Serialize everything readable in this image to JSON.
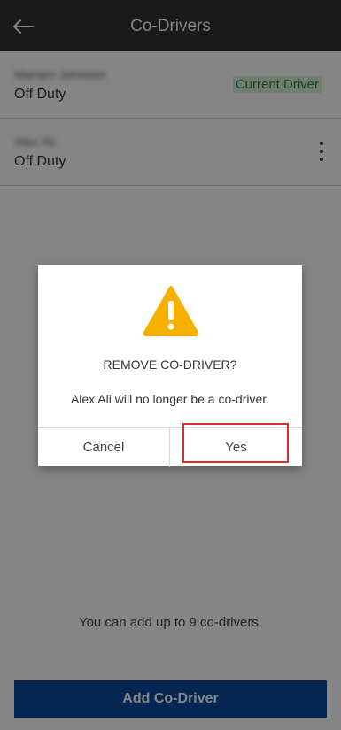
{
  "header": {
    "title": "Co-Drivers",
    "back_icon": "arrow-left-icon"
  },
  "drivers": [
    {
      "name": "Maham Johnson",
      "status": "Off Duty",
      "badge": "Current Driver"
    },
    {
      "name": "Alex Ali",
      "status": "Off Duty",
      "menu_icon": "more-vertical-icon"
    }
  ],
  "footer": {
    "hint": "You can add up to 9 co-drivers.",
    "add_button_label": "Add Co-Driver"
  },
  "dialog": {
    "icon": "warning-icon",
    "title": "REMOVE CO-DRIVER?",
    "message": "Alex Ali will no longer be a co-driver.",
    "cancel_label": "Cancel",
    "yes_label": "Yes"
  },
  "colors": {
    "topbar": "#333333",
    "accent": "#0a4aa0",
    "warning": "#f6b000",
    "current_badge_text": "#2e7d32",
    "current_badge_bg": "#d7f0d8",
    "highlight": "#d32f2f"
  }
}
